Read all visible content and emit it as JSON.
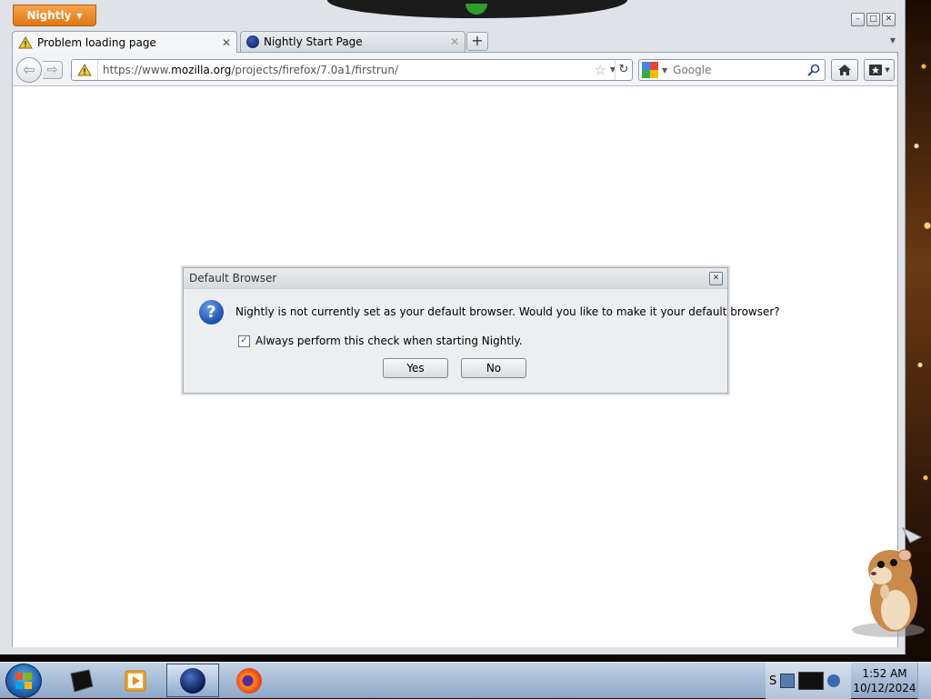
{
  "app_menu": {
    "label": "Nightly"
  },
  "window_controls": {
    "minimize": "–",
    "maximize": "□",
    "close": "✕"
  },
  "tabs": [
    {
      "title": "Problem loading page",
      "active": true
    },
    {
      "title": "Nightly Start Page",
      "active": false
    }
  ],
  "new_tab_label": "+",
  "navbar": {
    "url_prefix": "https://www.",
    "url_domain": "mozilla.org",
    "url_path": "/projects/firefox/7.0a1/firstrun/",
    "search_placeholder": "Google"
  },
  "dialog": {
    "title": "Default Browser",
    "message": "Nightly is not currently set as your default browser. Would you like to make it your default browser?",
    "checkbox_label": "Always perform this check when starting Nightly.",
    "checkbox_checked": true,
    "yes_label": "Yes",
    "no_label": "No"
  },
  "taskbar": {
    "tray_label": "S",
    "time": "1:52 AM",
    "date": "10/12/2024"
  },
  "colors": {
    "accent": "#e07812",
    "search_engine_colors": [
      "#4285f4",
      "#ea4335",
      "#fbbc05",
      "#34a853"
    ]
  }
}
